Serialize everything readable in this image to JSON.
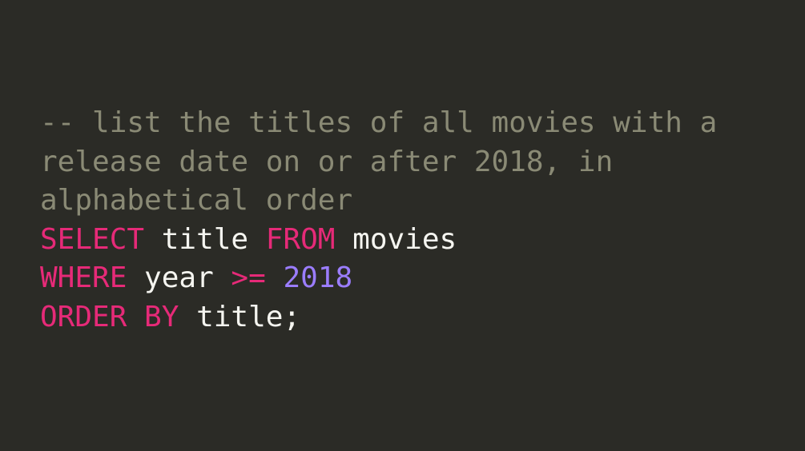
{
  "code": {
    "comment": "-- list the titles of all movies with a release date on or after 2018, in alphabetical order",
    "line1": {
      "kw_select": "SELECT",
      "col_title": " title ",
      "kw_from": "FROM",
      "tbl_movies": " movies"
    },
    "line2": {
      "kw_where": "WHERE",
      "col_year": " year ",
      "op_gte": ">=",
      "sp": " ",
      "num_2018": "2018"
    },
    "line3": {
      "kw_order_by": "ORDER BY",
      "col_title2": " title",
      "semi": ";"
    }
  }
}
